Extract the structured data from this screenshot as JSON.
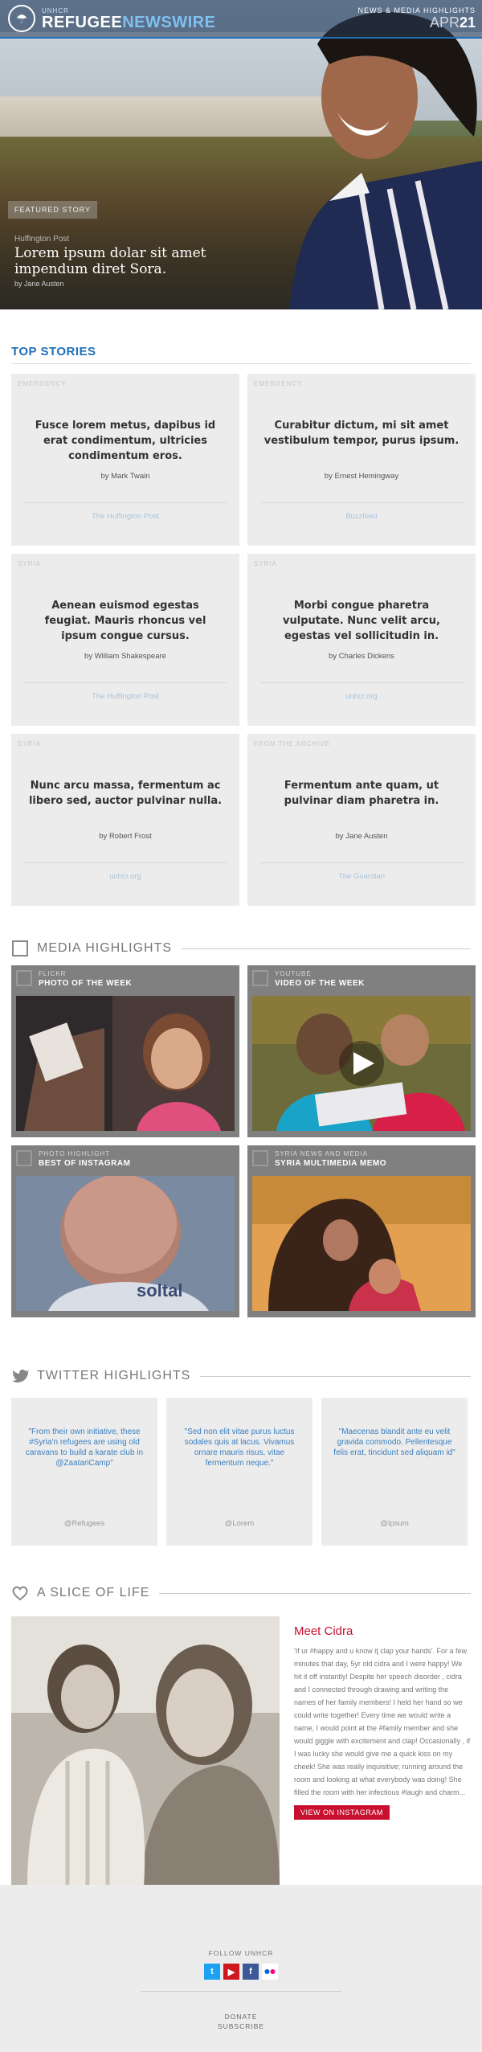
{
  "header": {
    "brand_small": "UNHCR",
    "brand_part1": "REFUGEE",
    "brand_part2": "NEWSWIRE",
    "top_label": "NEWS & MEDIA HIGHLIGHTS",
    "date_month": "APR",
    "date_day": "21"
  },
  "featured": {
    "tag": "FEATURED STORY",
    "source": "Huffington Post",
    "title": "Lorem ipsum dolar sit amet impendum diret Sora.",
    "byline": "by Jane Austen"
  },
  "top_stories": {
    "title": "TOP STORIES",
    "items": [
      {
        "category": "EMERGENCY",
        "headline": "Fusce lorem metus, dapibus id erat condimentum, ultricies condimentum eros.",
        "author": "by Mark Twain",
        "source": "The Huffington Post"
      },
      {
        "category": "EMERGENCY",
        "headline": "Curabitur dictum, mi sit amet vestibulum tempor, purus ipsum.",
        "author": "by Ernest Hemingway",
        "source": "Buzzfeed"
      },
      {
        "category": "SYRIA",
        "headline": "Aenean euismod egestas feugiat. Mauris rhoncus vel ipsum congue cursus.",
        "author": "by William Shakespeare",
        "source": "The Huffington Post"
      },
      {
        "category": "SYRIA",
        "headline": "Morbi congue pharetra vulputate. Nunc velit arcu, egestas vel sollicitudin in.",
        "author": "by Charles Dickens",
        "source": "unhcr.org"
      },
      {
        "category": "SYRIA",
        "headline": "Nunc arcu massa, fermentum ac libero sed, auctor pulvinar nulla.",
        "author": "by Robert Frost",
        "source": "unhcr.org"
      },
      {
        "category": "FROM THE ARCHIVE",
        "headline": "Fermentum ante quam, ut pulvinar diam pharetra in.",
        "author": "by Jane Austen",
        "source": "The Guardian"
      }
    ]
  },
  "media": {
    "title": "MEDIA HIGHLIGHTS",
    "items": [
      {
        "kicker": "FLICKR",
        "title": "PHOTO OF THE WEEK"
      },
      {
        "kicker": "YOUTUBE",
        "title": "VIDEO OF THE WEEK"
      },
      {
        "kicker": "PHOTO HIGHLIGHT",
        "title": "BEST OF INSTAGRAM"
      },
      {
        "kicker": "SYRIA NEWS AND MEDIA",
        "title": "SYRIA MULTIMEDIA MEMO"
      }
    ]
  },
  "twitter": {
    "title": "TWITTER HIGHLIGHTS",
    "items": [
      {
        "text": "\"From their own initiative, these #Syria'n refugees are using old caravans to build a karate club in @ZaatariCamp\"",
        "handle": "@Refugees"
      },
      {
        "text": "\"Sed non elit vitae purus luctus sodales quis at lacus. Vivamus ornare mauris risus, vitae fermentum neque.\"",
        "handle": "@Lorem"
      },
      {
        "text": "\"Maecenas blandit ante eu velit gravida commodo. Pellentesque felis erat, tincidunt sed aliquam id\"",
        "handle": "@Ipsum"
      }
    ]
  },
  "slice": {
    "title": "A SLICE OF LIFE",
    "name": "Meet Cidra",
    "text": "'If ur #happy and u know iţ clap your hands'. For a few minutes that day, 5yr old cidra and I were happy! We hit it off instantly! Despite her speech disorder , cidra and I connected through drawing and writing the names of her family members! I held her hand so we could write together! Every time we would write a name, I would point at the #family member and she would giggle with excitement and clap! Occasionally , if I was lucky she would give me a quick kiss on my cheek! She was really inquisitive; running around the room and looking at what everybody was doing! She filled the room with her infectious #laugh and charm...",
    "button": "VIEW ON INSTAGRAM"
  },
  "footer": {
    "follow": "FOLLOW UNHCR",
    "social": [
      {
        "icon": "twitter-icon",
        "glyph": "t",
        "color": "#1da1f2"
      },
      {
        "icon": "youtube-icon",
        "glyph": "▶",
        "color": "#cc181e"
      },
      {
        "icon": "facebook-icon",
        "glyph": "f",
        "color": "#3b5998"
      },
      {
        "icon": "flickr-icon",
        "glyph": "••",
        "color": "#ffffff"
      }
    ],
    "donate": "DONATE",
    "subscribe": "SUBSCRIBE"
  },
  "colors": {
    "brand_blue": "#1d6fb8",
    "accent_red": "#c8102e",
    "card_bg": "#ececec",
    "media_frame": "#808080"
  }
}
